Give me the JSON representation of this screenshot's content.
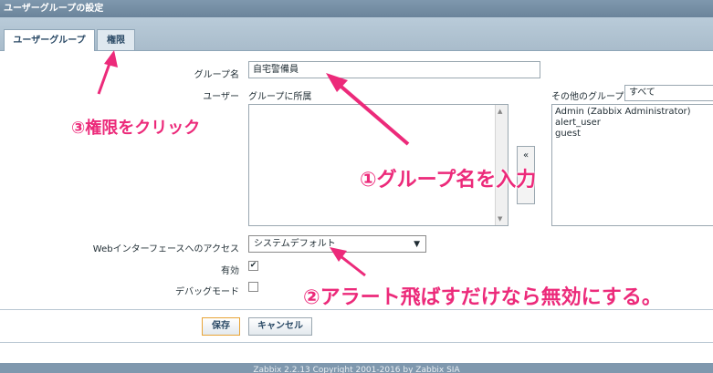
{
  "window": {
    "title": "ユーザーグループの設定"
  },
  "tabs": [
    {
      "label": "ユーザーグループ",
      "active": true
    },
    {
      "label": "権限",
      "active": false
    }
  ],
  "form": {
    "group_name_label": "グループ名",
    "group_name_value": "自宅警備員",
    "users_label": "ユーザー",
    "in_group_label": "グループに所属",
    "other_groups_label": "その他のグループ",
    "other_groups_filter": "すべて",
    "other_groups_items": [
      "Admin (Zabbix Administrator)",
      "alert_user",
      "guest"
    ],
    "move_left_button": "«",
    "frontend_access_label": "Webインターフェースへのアクセス",
    "frontend_access_value": "システムデフォルト",
    "enabled_label": "有効",
    "enabled_checked": true,
    "debug_label": "デバッグモード",
    "debug_checked": false
  },
  "buttons": {
    "save": "保存",
    "cancel": "キャンセル"
  },
  "footer": {
    "text": "Zabbix 2.2.13 Copyright 2001-2016 by Zabbix SIA"
  },
  "annotations": {
    "step1": "①グループ名を入力",
    "step2": "②アラート飛ばすだけなら無効にする。",
    "step3": "③権限をクリック"
  },
  "colors": {
    "annotation": "#ec2a7a",
    "header": "#7f98ae",
    "tabstrip": "#b9cbd9"
  }
}
